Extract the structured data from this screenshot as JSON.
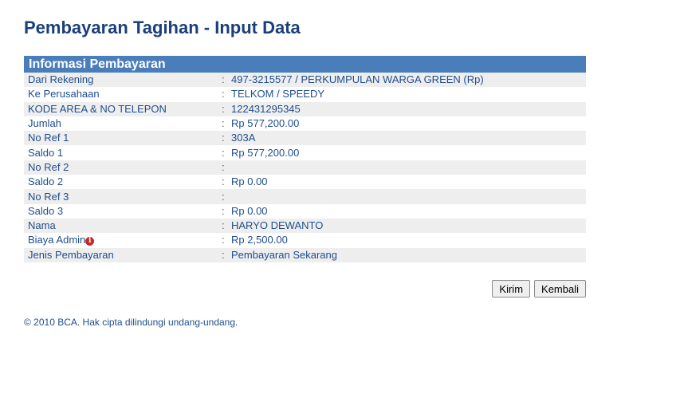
{
  "page": {
    "title": "Pembayaran Tagihan - Input Data"
  },
  "panel": {
    "header": "Informasi Pembayaran",
    "separator": ":",
    "rows": [
      {
        "label": "Dari Rekening",
        "value": "497-3215577 / PERKUMPULAN WARGA GREEN (Rp)"
      },
      {
        "label": "Ke Perusahaan",
        "value": "TELKOM / SPEEDY"
      },
      {
        "label": "KODE AREA & NO TELEPON",
        "value": "122431295345"
      },
      {
        "label": "Jumlah",
        "value": "Rp 577,200.00"
      },
      {
        "label": "No Ref 1",
        "value": "303A"
      },
      {
        "label": "Saldo 1",
        "value": "Rp 577,200.00"
      },
      {
        "label": "No Ref 2",
        "value": ""
      },
      {
        "label": "Saldo 2",
        "value": "Rp 0.00"
      },
      {
        "label": "No Ref 3",
        "value": ""
      },
      {
        "label": "Saldo 3",
        "value": "Rp 0.00"
      },
      {
        "label": "Nama",
        "value": "HARYO DEWANTO"
      },
      {
        "label": "Biaya Admin",
        "value": "Rp 2,500.00",
        "icon": "info-icon"
      },
      {
        "label": "Jenis Pembayaran",
        "value": "Pembayaran Sekarang"
      }
    ]
  },
  "buttons": {
    "submit_label": "Kirim",
    "back_label": "Kembali"
  },
  "footer": {
    "copyright": "©  2010 BCA. Hak cipta dilindungi undang-undang."
  },
  "colors": {
    "header_bg": "#4a7ebb",
    "text": "#1f4e8c",
    "row_alt": "#eeeeee",
    "icon_red": "#c62828"
  }
}
